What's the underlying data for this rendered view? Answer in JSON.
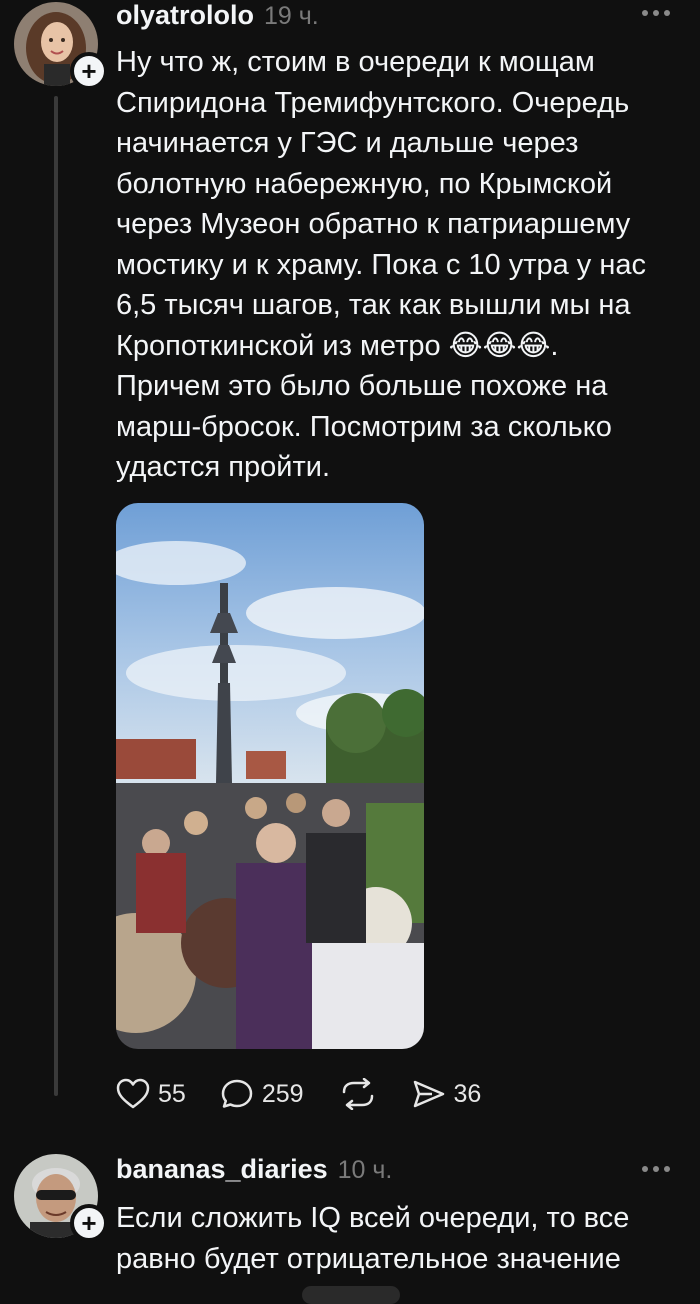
{
  "colors": {
    "background": "#101010",
    "text": "#f3f5f7",
    "muted": "#7a7a7a"
  },
  "post": {
    "username": "olyatrololo",
    "time": "19 ч.",
    "text": "Ну что ж, стоим в очереди к мощам\nСпиридона Тремифунтского. Очередь\nначинается у ГЭС и дальше через\nболотную набережную, по Крымской\nчерез Музеон обратно к патриаршему\nмостику и к храму. Пока с 10 утра у нас\n6,5 тысяч шагов, так как вышли мы на\nКропоткинской из метро 😂😂😂.\nПричем это было больше похоже на\nмарш-бросок. Посмотрим за сколько\nудастся пройти.",
    "likes": "55",
    "comments": "259",
    "shares": "36",
    "icons": [
      "heart-icon",
      "comment-icon",
      "repost-icon",
      "send-icon"
    ]
  },
  "reply": {
    "username": "bananas_diaries",
    "time": "10 ч.",
    "text": "Если сложить IQ всей очереди, то все\nравно будет отрицательное значение"
  }
}
